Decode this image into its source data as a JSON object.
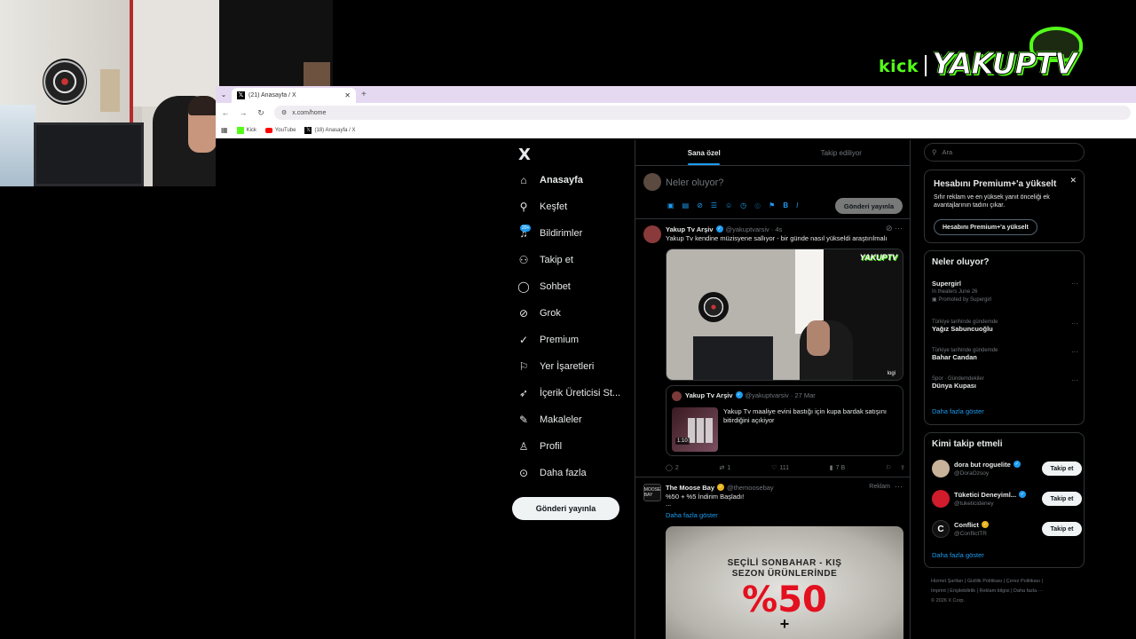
{
  "overlay": {
    "kick": "kick",
    "channel": "YAKUPTV",
    "accent": "#53fc18"
  },
  "browser": {
    "tab_title": "(21) Anasayfa / X",
    "url": "x.com/home",
    "bookmarks": [
      {
        "label": "Kick",
        "icon": "kick-icon"
      },
      {
        "label": "YouTube",
        "icon": "youtube-icon"
      },
      {
        "label": "(18) Anasayfa / X",
        "icon": "x-icon"
      }
    ]
  },
  "nav": {
    "logo": "X",
    "notif_badge": "20+",
    "items": [
      {
        "label": "Anasayfa",
        "icon": "home-icon"
      },
      {
        "label": "Keşfet",
        "icon": "search-icon"
      },
      {
        "label": "Bildirimler",
        "icon": "bell-icon"
      },
      {
        "label": "Takip et",
        "icon": "follow-icon"
      },
      {
        "label": "Sohbet",
        "icon": "chat-icon"
      },
      {
        "label": "Grok",
        "icon": "grok-icon"
      },
      {
        "label": "Premium",
        "icon": "premium-icon"
      },
      {
        "label": "Yer İşaretleri",
        "icon": "bookmark-icon"
      },
      {
        "label": "İçerik Üreticisi St...",
        "icon": "rocket-icon"
      },
      {
        "label": "Makaleler",
        "icon": "articles-icon"
      },
      {
        "label": "Profil",
        "icon": "profile-icon"
      },
      {
        "label": "Daha fazla",
        "icon": "more-icon"
      }
    ],
    "post_button": "Gönderi yayınla"
  },
  "timeline": {
    "tabs": [
      "Sana özel",
      "Takip ediliyor"
    ],
    "compose_placeholder": "Neler oluyor?",
    "compose_button": "Gönderi yayınla",
    "tweet1": {
      "name": "Yakup Tv Arşiv",
      "handle": "@yakuptvarsiv · 4s",
      "text": "Yakup Tv kendine müzisyene sallıyor - bir günde nasıl yükseldi araştırılmalı",
      "media_logo": "YAKUPTV",
      "media_tag": "logi",
      "quote": {
        "name": "Yakup Tv Arşiv",
        "handle": "@yakuptvarsiv · 27 Mar",
        "text": "Yakup Tv maaliye evini bastığı için kupa bardak satışını bitirdiğini açıkiyor",
        "duration": "1:10"
      },
      "stats": {
        "replies": "2",
        "reposts": "1",
        "likes": "111",
        "views": "7 B"
      }
    },
    "tweet2": {
      "name": "The Moose Bay",
      "handle": "@themoosebay",
      "ad_label": "Reklam",
      "text": "%50 + %5 İndirim Başladı!",
      "ellipsis": "...",
      "show_more": "Daha fazla göster",
      "avatar_text": "MOOSE BAY",
      "media_line1": "SEÇİLİ SONBAHAR - KIŞ",
      "media_line2": "SEZON ÜRÜNLERİNDE",
      "media_big": "%50",
      "media_plus": "+"
    }
  },
  "right": {
    "search_placeholder": "Ara",
    "premium": {
      "title": "Hesabını Premium+'a yükselt",
      "desc": "Sıfır reklam ve en yüksek yanıt önceliği ek avantajlarının tadını çıkar.",
      "button": "Hesabını Premium+'a yükselt"
    },
    "trends": {
      "title": "Neler oluyor?",
      "items": [
        {
          "context": "",
          "title": "Supergirl",
          "sub": "In theaters June 26",
          "promo": "Promoted by Supergirl"
        },
        {
          "context": "Türkiye tarihinde gündemde",
          "title": "Yağız Sabuncuoğlu",
          "sub": "",
          "promo": ""
        },
        {
          "context": "Türkiye tarihinde gündemde",
          "title": "Bahar Candan",
          "sub": "",
          "promo": ""
        },
        {
          "context": "Spor · Gündemdekiler",
          "title": "Dünya Kupası",
          "sub": "",
          "promo": ""
        }
      ],
      "more": "Daha fazla göster"
    },
    "follow": {
      "title": "Kimi takip etmeli",
      "items": [
        {
          "name": "dora but roguelite",
          "handle": "@DoraOzsoy",
          "badge": "blue",
          "button": "Takip et"
        },
        {
          "name": "Tüketici Deneyiml...",
          "handle": "@tuketicideney",
          "badge": "blue",
          "button": "Takip et"
        },
        {
          "name": "Conflict",
          "handle": "@ConflictTR",
          "badge": "gold",
          "button": "Takip et"
        }
      ],
      "more": "Daha fazla göster"
    },
    "footer": {
      "line1": "Hizmet Şartları  |  Gizlilik Politikası  |  Çerez Politikası  |",
      "line2": "Imprint  |  Erişilebilirlik  |  Reklam bilgisi  |  Daha fazla ···",
      "line3": "© 2026 X Corp."
    }
  }
}
